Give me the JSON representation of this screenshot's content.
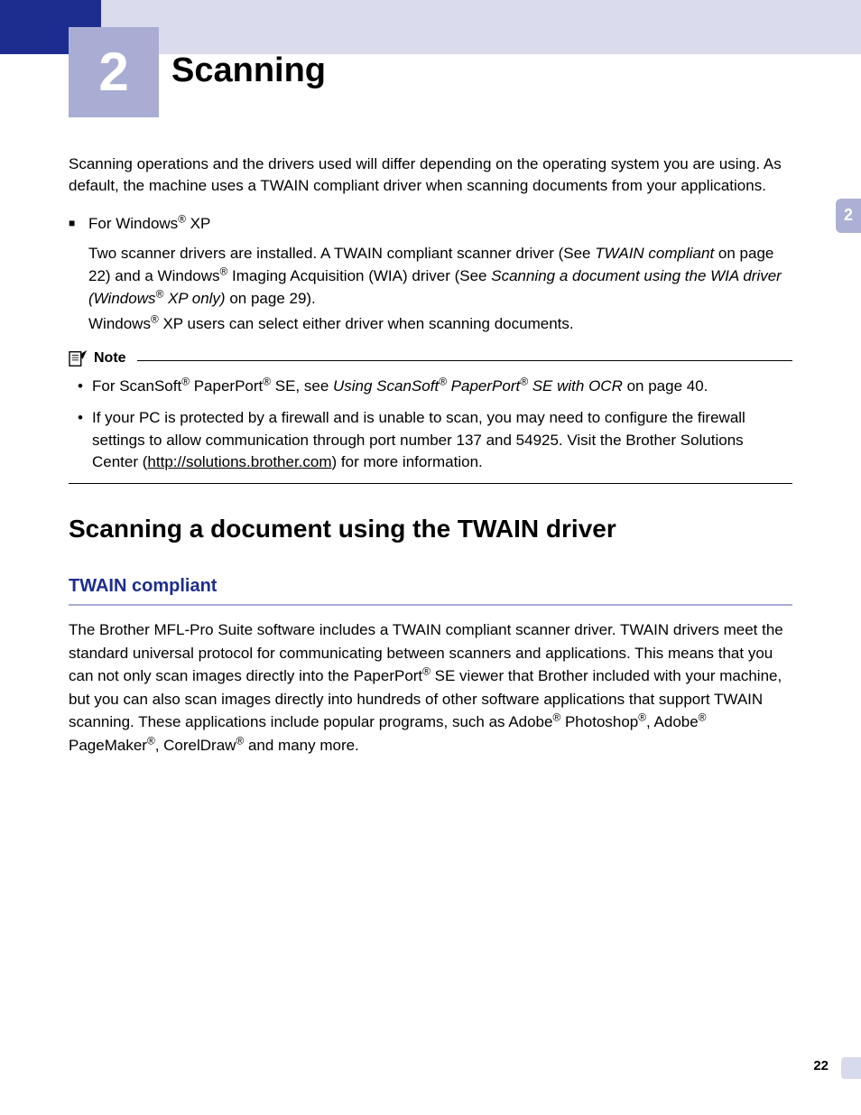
{
  "chapter": {
    "number": "2",
    "title": "Scanning"
  },
  "sideTab": "2",
  "intro": "Scanning operations and the drivers used will differ depending on the operating system you are using. As default, the machine uses a TWAIN compliant driver when scanning documents from your applications.",
  "winxp": {
    "label_prefix": "For Windows",
    "label_suffix": " XP",
    "para1_a": "Two scanner drivers are installed. A TWAIN compliant scanner driver (See ",
    "para1_link": "TWAIN compliant",
    "para1_b": " on page 22) and a Windows",
    "para1_c": " Imaging Acquisition (WIA) driver (See ",
    "para1_link2": "Scanning a document using the WIA driver (Windows",
    "para1_link2b": " XP only)",
    "para1_d": " on page 29).",
    "para2_a": "Windows",
    "para2_b": " XP users can select either driver when scanning documents."
  },
  "note": {
    "label": "Note",
    "b1_a": "For ScanSoft",
    "b1_b": " PaperPort",
    "b1_c": " SE, see ",
    "b1_link_a": "Using ScanSoft",
    "b1_link_b": " PaperPort",
    "b1_link_c": " SE with OCR",
    "b1_d": " on page 40.",
    "b2_a": "If your PC is protected by a firewall and is unable to scan, you may need to configure the firewall settings to allow communication through port number 137 and 54925. Visit the Brother Solutions Center (",
    "b2_link": "http://solutions.brother.com",
    "b2_b": ") for more information."
  },
  "section": "Scanning a document using the TWAIN driver",
  "subsection": "TWAIN compliant",
  "body_a": "The Brother MFL-Pro Suite software includes a TWAIN compliant scanner driver. TWAIN drivers meet the standard universal protocol for communicating between scanners and applications. This means that you can not only scan images directly into the PaperPort",
  "body_b": " SE viewer that Brother included with your machine, but you can also scan images directly into hundreds of other software applications that support TWAIN scanning. These applications include popular programs, such as Adobe",
  "body_c": " Photoshop",
  "body_d": ", Adobe",
  "body_e": " PageMaker",
  "body_f": ", CorelDraw",
  "body_g": " and many more.",
  "pageNum": "22"
}
